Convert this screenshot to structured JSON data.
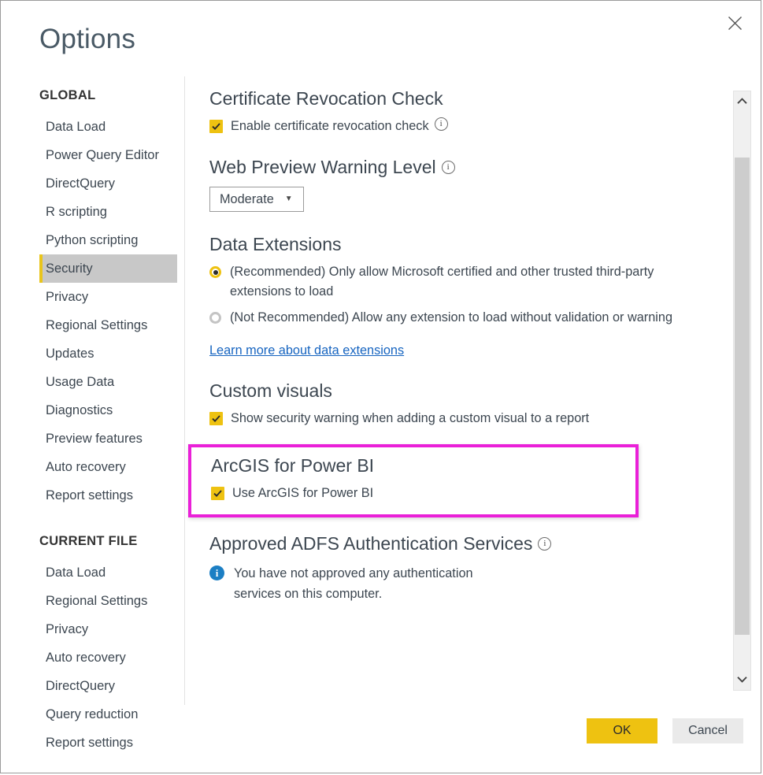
{
  "dialog": {
    "title": "Options",
    "close_icon": "close-icon"
  },
  "sidebar": {
    "groups": [
      {
        "title": "GLOBAL",
        "items": [
          {
            "label": "Data Load",
            "selected": false
          },
          {
            "label": "Power Query Editor",
            "selected": false
          },
          {
            "label": "DirectQuery",
            "selected": false
          },
          {
            "label": "R scripting",
            "selected": false
          },
          {
            "label": "Python scripting",
            "selected": false
          },
          {
            "label": "Security",
            "selected": true
          },
          {
            "label": "Privacy",
            "selected": false
          },
          {
            "label": "Regional Settings",
            "selected": false
          },
          {
            "label": "Updates",
            "selected": false
          },
          {
            "label": "Usage Data",
            "selected": false
          },
          {
            "label": "Diagnostics",
            "selected": false
          },
          {
            "label": "Preview features",
            "selected": false
          },
          {
            "label": "Auto recovery",
            "selected": false
          },
          {
            "label": "Report settings",
            "selected": false
          }
        ]
      },
      {
        "title": "CURRENT FILE",
        "items": [
          {
            "label": "Data Load",
            "selected": false
          },
          {
            "label": "Regional Settings",
            "selected": false
          },
          {
            "label": "Privacy",
            "selected": false
          },
          {
            "label": "Auto recovery",
            "selected": false
          },
          {
            "label": "DirectQuery",
            "selected": false
          },
          {
            "label": "Query reduction",
            "selected": false
          },
          {
            "label": "Report settings",
            "selected": false
          }
        ]
      }
    ]
  },
  "content": {
    "certificate_revocation": {
      "heading": "Certificate Revocation Check",
      "checkbox_label": "Enable certificate revocation check",
      "checkbox_checked": true,
      "info_icon": "info-icon"
    },
    "web_preview_warning": {
      "heading": "Web Preview Warning Level",
      "info_icon": "info-icon",
      "dropdown_value": "Moderate",
      "dropdown_caret": "chevron-down-icon"
    },
    "data_extensions": {
      "heading": "Data Extensions",
      "options": [
        {
          "label": "(Recommended) Only allow Microsoft certified and other trusted third-party extensions to load",
          "selected": true
        },
        {
          "label": "(Not Recommended) Allow any extension to load without validation or warning",
          "selected": false
        }
      ],
      "link_text": "Learn more about data extensions"
    },
    "custom_visuals": {
      "heading": "Custom visuals",
      "checkbox_label": "Show security warning when adding a custom visual to a report",
      "checkbox_checked": true
    },
    "arcgis": {
      "heading": "ArcGIS for Power BI",
      "checkbox_label": "Use ArcGIS for Power BI",
      "checkbox_checked": true,
      "highlighted": true
    },
    "adfs": {
      "heading": "Approved ADFS Authentication Services",
      "info_icon": "info-icon",
      "note_icon": "info-filled-icon",
      "note_text": "You have not approved any authentication services on this computer."
    }
  },
  "scrollbar": {
    "up_arrow": "chevron-up-icon",
    "down_arrow": "chevron-down-icon",
    "thumb": "scrollbar-thumb"
  },
  "footer": {
    "ok_label": "OK",
    "cancel_label": "Cancel"
  },
  "colors": {
    "accent_yellow": "#eec211",
    "highlight_magenta": "#ea20d8",
    "link_blue": "#1664c0",
    "info_blue": "#1c7fc4",
    "selected_nav_bg": "#c8c8c8",
    "text": "#3c4650"
  }
}
